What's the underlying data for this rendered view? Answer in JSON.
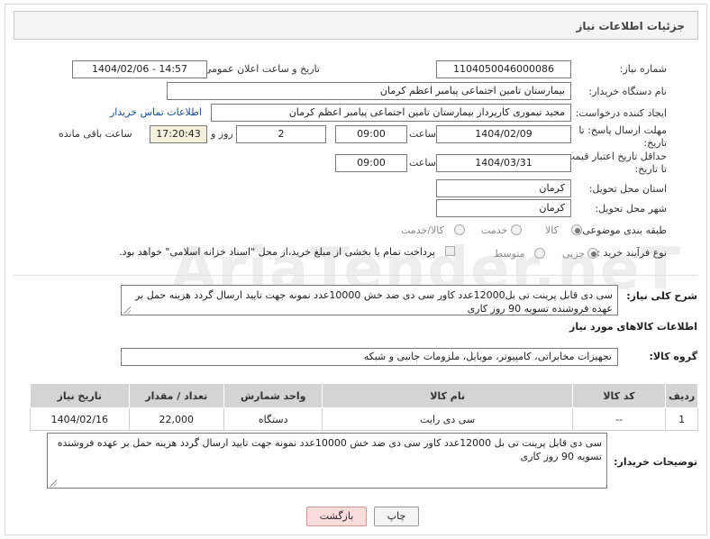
{
  "header": {
    "title": "جزئیات اطلاعات نیاز"
  },
  "watermark": "AriaTender.neT",
  "need_number": {
    "label": "شماره نیاز:",
    "value": "1104050046000086"
  },
  "announce_datetime": {
    "label": "تاریخ و ساعت اعلان عمومی:",
    "value": "1404/02/06 - 14:57"
  },
  "buyer_org": {
    "label": "نام دستگاه خریدار:",
    "value": "بیمارستان تامین اجتماعی پیامبر اعظم کرمان"
  },
  "requester": {
    "label": "ایجاد کننده درخواست:",
    "value": "مجید تیموری کارپرداز بیمارستان تامین اجتماعی پیامبر اعظم کرمان",
    "contact_link": "اطلاعات تماس خریدار"
  },
  "reply_deadline": {
    "label_line1": "مهلت ارسال پاسخ: تا",
    "label_line2": "تاریخ:",
    "date": "1404/02/09",
    "time_label": "ساعت",
    "time": "09:00",
    "days": "2",
    "days_label": "روز و",
    "remaining_time": "17:20:43",
    "remaining_label": "ساعت باقی مانده"
  },
  "price_validity": {
    "label_line1": "حداقل تاریخ اعتبار قیمت:",
    "label_line2": "تا تاریخ:",
    "date": "1404/03/31",
    "time_label": "ساعت",
    "time": "09:00"
  },
  "delivery_province": {
    "label": "استان محل تحویل:",
    "value": "کرمان"
  },
  "delivery_city": {
    "label": "شهر محل تحویل:",
    "value": "کرمان"
  },
  "category": {
    "label": "طبقه بندی موضوعی:",
    "options": [
      "کالا",
      "خدمت",
      "کالا/خدمت"
    ],
    "selected": "کالا"
  },
  "process_type": {
    "label": "نوع فرآیند خرید :",
    "options": [
      "جزیی",
      "متوسط"
    ],
    "selected": "جزیی",
    "payment_note": "پرداخت تمام یا بخشی از مبلغ خرید،از محل \"اسناد خزانه اسلامی\" خواهد بود."
  },
  "general_description": {
    "label": "شرح کلی نیاز:",
    "value": "سی دی قابل پرینت تی بل12000عدد کاور سی دی ضد خش 10000عدد نمونه جهت تایید ارسال گردد هزینه حمل بر عهده فروشنده تسویه 90 روز کاری"
  },
  "goods_section_title": "اطلاعات کالاهای مورد نیاز",
  "goods_group": {
    "label": "گروه کالا:",
    "value": "تجهیزات مخابراتی، کامپیوتر، موبایل، ملزومات جانبی و شبکه"
  },
  "items_table": {
    "headers": [
      "ردیف",
      "کد کالا",
      "نام کالا",
      "واحد شمارش",
      "تعداد / مقدار",
      "تاریخ نیاز"
    ],
    "rows": [
      {
        "row": "1",
        "code": "--",
        "name": "سی دی رایت",
        "unit": "دستگاه",
        "qty": "22,000",
        "date": "1404/02/16"
      }
    ]
  },
  "buyer_notes": {
    "label": "توضیحات خریدار:",
    "value": "سی دی قابل پرینت تی بل 12000عدد کاور سی دی ضد خش 10000عدد نمونه جهت تایید ارسال گردد هزینه حمل بر عهده فروشنده تسویه 90 روز کاری"
  },
  "buttons": {
    "print": "چاپ",
    "back": "بازگشت"
  }
}
